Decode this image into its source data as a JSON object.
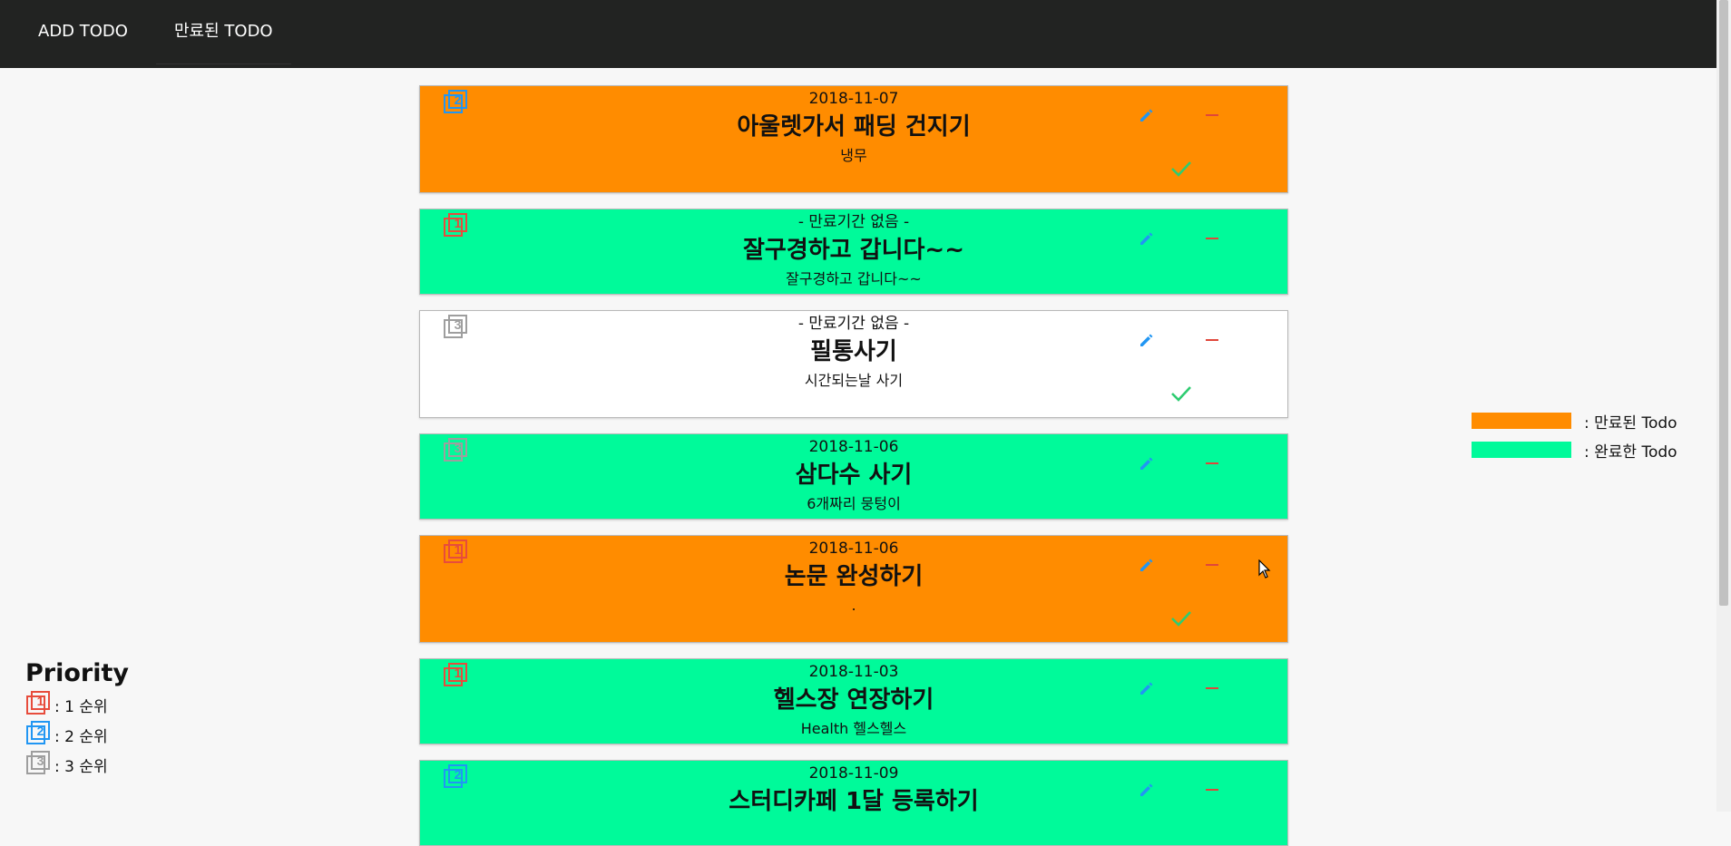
{
  "nav": {
    "add_label": "ADD TODO",
    "expired_label": "만료된 TODO"
  },
  "todos": [
    {
      "priority": "2",
      "date": "2018-11-07",
      "title": "아울렛가서 패딩 건지기",
      "desc": "냉무",
      "state": "expired",
      "has_check": true
    },
    {
      "priority": "1",
      "date": "- 만료기간 없음 -",
      "title": "잘구경하고 갑니다~~",
      "desc": "잘구경하고 갑니다~~",
      "state": "done",
      "has_check": false
    },
    {
      "priority": "3",
      "date": "- 만료기간 없음 -",
      "title": "필통사기",
      "desc": "시간되는날 사기",
      "state": "normal",
      "has_check": true
    },
    {
      "priority": "3",
      "date": "2018-11-06",
      "title": "삼다수 사기",
      "desc": "6개짜리 뭉텅이",
      "state": "done",
      "has_check": false
    },
    {
      "priority": "1",
      "date": "2018-11-06",
      "title": "논문 완성하기",
      "desc": ".",
      "state": "expired",
      "has_check": true
    },
    {
      "priority": "1",
      "date": "2018-11-03",
      "title": "헬스장 연장하기",
      "desc": "Health 헬스헬스",
      "state": "done",
      "has_check": false
    },
    {
      "priority": "2",
      "date": "2018-11-09",
      "title": "스터디카페 1달 등록하기",
      "desc": "",
      "state": "done",
      "has_check": false
    }
  ],
  "legend": {
    "expired_label": ": 만료된 Todo",
    "done_label": ": 완료한 Todo",
    "expired_color": "#ff8c00",
    "done_color": "#00fa9a"
  },
  "priority_legend": {
    "title": "Priority",
    "items": [
      {
        "num": "1",
        "label": ": 1 순위",
        "color": "#e74c3c"
      },
      {
        "num": "2",
        "label": ": 2 순위",
        "color": "#2196f3"
      },
      {
        "num": "3",
        "label": ": 3 순위",
        "color": "#9e9e9e"
      }
    ]
  },
  "colors": {
    "edit_icon": "#2196f3",
    "remove_icon": "#e0463a",
    "check_icon": "#2ecc71"
  }
}
